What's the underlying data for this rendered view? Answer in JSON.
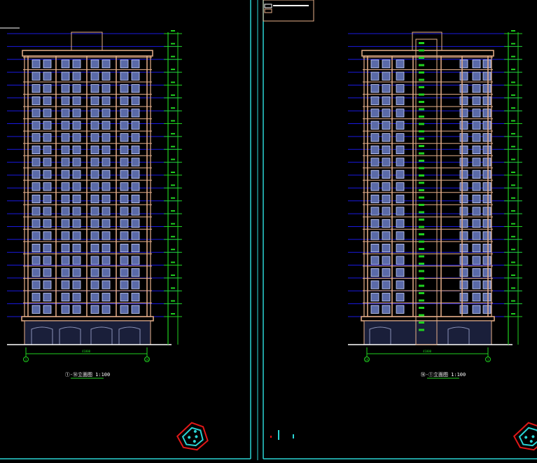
{
  "drawing": {
    "background": "#000000",
    "colors": {
      "facade": "#e8b08a",
      "glass": "#5a6aa8",
      "level_line": "#1a1ae0",
      "dimension": "#1fd11f",
      "frame": "#2ad4d4",
      "marker_red": "#e01818",
      "white": "#ffffff"
    },
    "elevations": [
      {
        "caption": "①-⑭立面图 1:100",
        "axis_left": "1",
        "axis_right": "14",
        "total_dim": "41800",
        "floors": 19
      },
      {
        "caption": "⑭-①立面图 1:100",
        "axis_left": "14",
        "axis_right": "1",
        "total_dim": "41800",
        "floors": 19
      }
    ],
    "icons": [
      "north-arrow-icon",
      "compass-icon"
    ]
  }
}
